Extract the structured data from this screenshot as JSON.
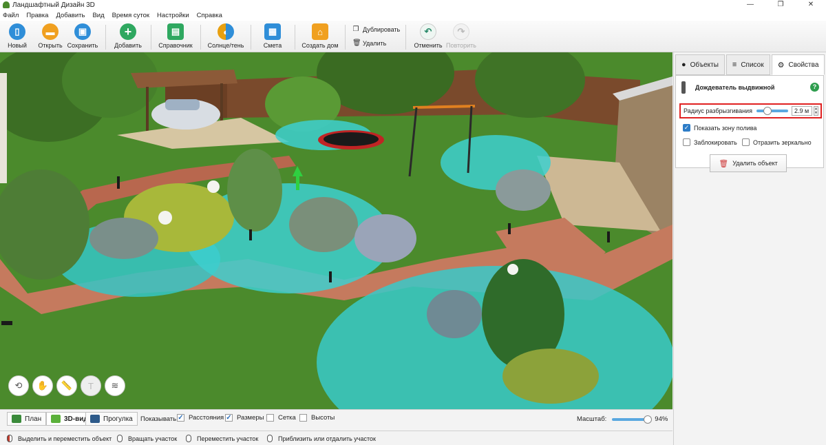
{
  "app": {
    "title": "Ландшафтный Дизайн 3D",
    "win_controls": [
      "—",
      "❐",
      "✕"
    ]
  },
  "menu": [
    "Файл",
    "Правка",
    "Добавить",
    "Вид",
    "Время суток",
    "Настройки",
    "Справка"
  ],
  "toolbar": {
    "new": "Новый",
    "open": "Открыть",
    "save": "Сохранить",
    "add": "Добавить",
    "reference": "Справочник",
    "sun_shade": "Солнце/тень",
    "estimate": "Смета",
    "create_house": "Создать дом",
    "duplicate": "Дублировать",
    "delete": "Удалить",
    "undo": "Отменить",
    "redo": "Повторить",
    "colors": {
      "blue": "#2f8ed8",
      "orange": "#f0a020",
      "green": "#2fa860",
      "gold": "#e8a010"
    }
  },
  "panel": {
    "tabs": [
      {
        "label": "Объекты",
        "icon": "objects-icon"
      },
      {
        "label": "Список",
        "icon": "layers-icon"
      },
      {
        "label": "Свойства",
        "icon": "gear-icon"
      }
    ],
    "active_tab": "Свойства",
    "object_name": "Дождеватель выдвижной",
    "help": "?",
    "radius_label": "Радиус разбрызгивания",
    "radius_value": "2.9 м",
    "radius_fraction": 0.18,
    "show_zone": "Показать зону полива",
    "show_zone_checked": true,
    "lock": "Заблокировать",
    "lock_checked": false,
    "mirror": "Отразить зеркально",
    "mirror_checked": false,
    "delete_object": "Удалить объект"
  },
  "viewbar": {
    "plan": "План",
    "view3d": "3D-вид",
    "walk": "Прогулка",
    "active_view": "3D-вид",
    "show_label": "Показывать:",
    "distances": "Расстояния",
    "distances_checked": true,
    "sizes": "Размеры",
    "sizes_checked": true,
    "grid": "Сетка",
    "grid_checked": false,
    "heights": "Высоты",
    "heights_checked": false,
    "zoom_label": "Масштаб:",
    "zoom_value": "94%",
    "zoom_fraction": 0.94
  },
  "status": {
    "select_move": "Выделить и переместить объект",
    "rotate": "Вращать участок",
    "move_plot": "Переместить участок",
    "zoom": "Приблизить или отдалить участок"
  }
}
